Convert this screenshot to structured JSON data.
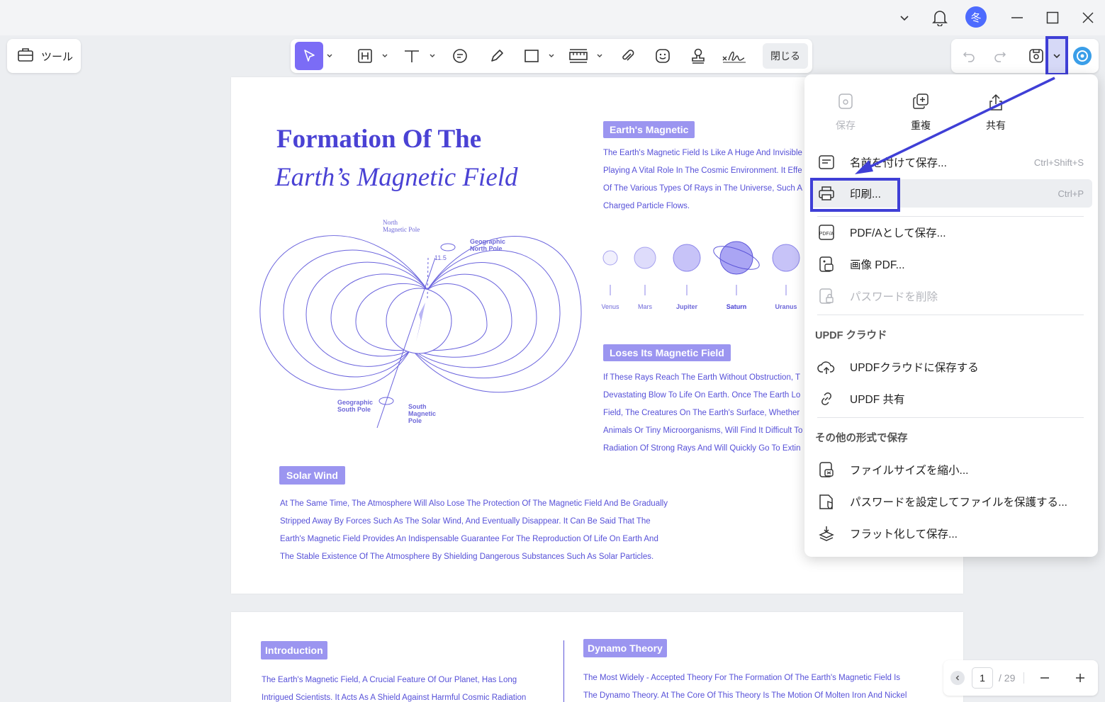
{
  "titlebar": {
    "avatar_letter": "冬",
    "icons": [
      "chevron-down-icon",
      "bell-icon",
      "minimize-icon",
      "maximize-icon",
      "close-icon"
    ]
  },
  "toolbar": {
    "tools_label": "ツール",
    "close_label": "閉じる",
    "icons": [
      "select-icon",
      "highlight-icon",
      "text-icon",
      "comment-icon",
      "pen-icon",
      "rectangle-icon",
      "measure-icon",
      "attachment-icon",
      "sticker-icon",
      "stamp-icon",
      "signature-icon"
    ],
    "right_icons": [
      "undo-icon",
      "redo-icon",
      "save-icon",
      "chevron-down-icon",
      "ai-assistant-icon"
    ]
  },
  "page1": {
    "title_line1": "Formation Of The",
    "title_line2": "Earth’s Magnetic Field",
    "diagram_labels": {
      "north_magnetic": [
        "North",
        "Magnetic Pole"
      ],
      "geo_north": [
        "Geographic",
        "North Pole"
      ],
      "angle": "11.5",
      "geo_south": [
        "Geographic",
        "South Pole"
      ],
      "south_magnetic": [
        "South",
        "Magnetic",
        "Pole"
      ]
    },
    "earth_magnetic": {
      "heading": "Earth's Magnetic",
      "lines": [
        "The Earth's Magnetic Field Is Like A Huge And Invisible",
        "Playing A Vital Role In The Cosmic Environment. It Effe",
        "Of The Various Types Of Rays in The Universe, Such A",
        "Charged Particle Flows."
      ]
    },
    "planets": [
      "Venus",
      "Mars",
      "Jupiter",
      "Saturn",
      "Uranus"
    ],
    "loses_field": {
      "heading": "Loses Its Magnetic Field",
      "lines": [
        "If These Rays Reach The Earth Without Obstruction, T",
        "Devastating Blow To Life On Earth. Once The Earth Lo",
        "Field, The Creatures On The Earth's Surface, Whether",
        "Animals Or Tiny Microorganisms, Will Find It Difficult To",
        "Radiation Of Strong Rays And Will Quickly Go To Extin"
      ]
    },
    "solar_wind": {
      "heading": "Solar Wind",
      "lines": [
        "At The Same Time, The Atmosphere Will Also Lose The Protection Of The Magnetic Field And Be Gradually",
        "Stripped Away By Forces Such As The Solar Wind, And Eventually Disappear. It Can Be Said That The",
        "Earth's Magnetic Field Provides An Indispensable Guarantee For The Reproduction Of Life On Earth And",
        "The Stable Existence Of The Atmosphere By Shielding Dangerous Substances Such As Solar Particles."
      ]
    }
  },
  "page2": {
    "intro_heading": "Introduction",
    "intro_lines": [
      "The Earth's Magnetic Field, A Crucial Feature Of Our Planet, Has Long",
      "Intrigued Scientists. It Acts As A Shield Against Harmful Cosmic Radiation"
    ],
    "dynamo_heading": "Dynamo Theory",
    "dynamo_lines": [
      "The Most Widely - Accepted Theory For The Formation Of The Earth's Magnetic Field Is",
      "The Dynamo Theory. At The Core Of This Theory Is The Motion Of Molten Iron And Nickel"
    ]
  },
  "menu": {
    "quick_actions": [
      {
        "label": "保存",
        "icon": "save-icon",
        "disabled": true
      },
      {
        "label": "重複",
        "icon": "duplicate-icon",
        "disabled": false
      },
      {
        "label": "共有",
        "icon": "share-icon",
        "disabled": false
      }
    ],
    "items": [
      {
        "label": "名前を付けて保存...",
        "shortcut": "Ctrl+Shift+S",
        "icon": "save-as-icon"
      },
      {
        "label": "印刷...",
        "shortcut": "Ctrl+P",
        "icon": "printer-icon"
      },
      {
        "label": "PDF/Aとして保存...",
        "shortcut": "",
        "icon": "pdfa-icon"
      },
      {
        "label": "画像 PDF...",
        "shortcut": "",
        "icon": "image-pdf-icon"
      },
      {
        "label": "パスワードを削除",
        "shortcut": "",
        "icon": "remove-password-icon"
      }
    ],
    "cloud_title": "UPDF クラウド",
    "cloud_items": [
      {
        "label": "UPDFクラウドに保存する",
        "icon": "cloud-upload-icon"
      },
      {
        "label": "UPDF 共有",
        "icon": "link-icon"
      }
    ],
    "other_title": "その他の形式で保存",
    "other_items": [
      {
        "label": "ファイルサイズを縮小...",
        "icon": "compress-icon"
      },
      {
        "label": "パスワードを設定してファイルを保護する...",
        "icon": "protect-icon"
      },
      {
        "label": "フラット化して保存...",
        "icon": "flatten-icon"
      }
    ]
  },
  "pager": {
    "current": "1",
    "total": "/ 29"
  },
  "colors": {
    "accent": "#4a42d4",
    "badge": "#9b95f0",
    "highlight": "#3f3fd6"
  }
}
